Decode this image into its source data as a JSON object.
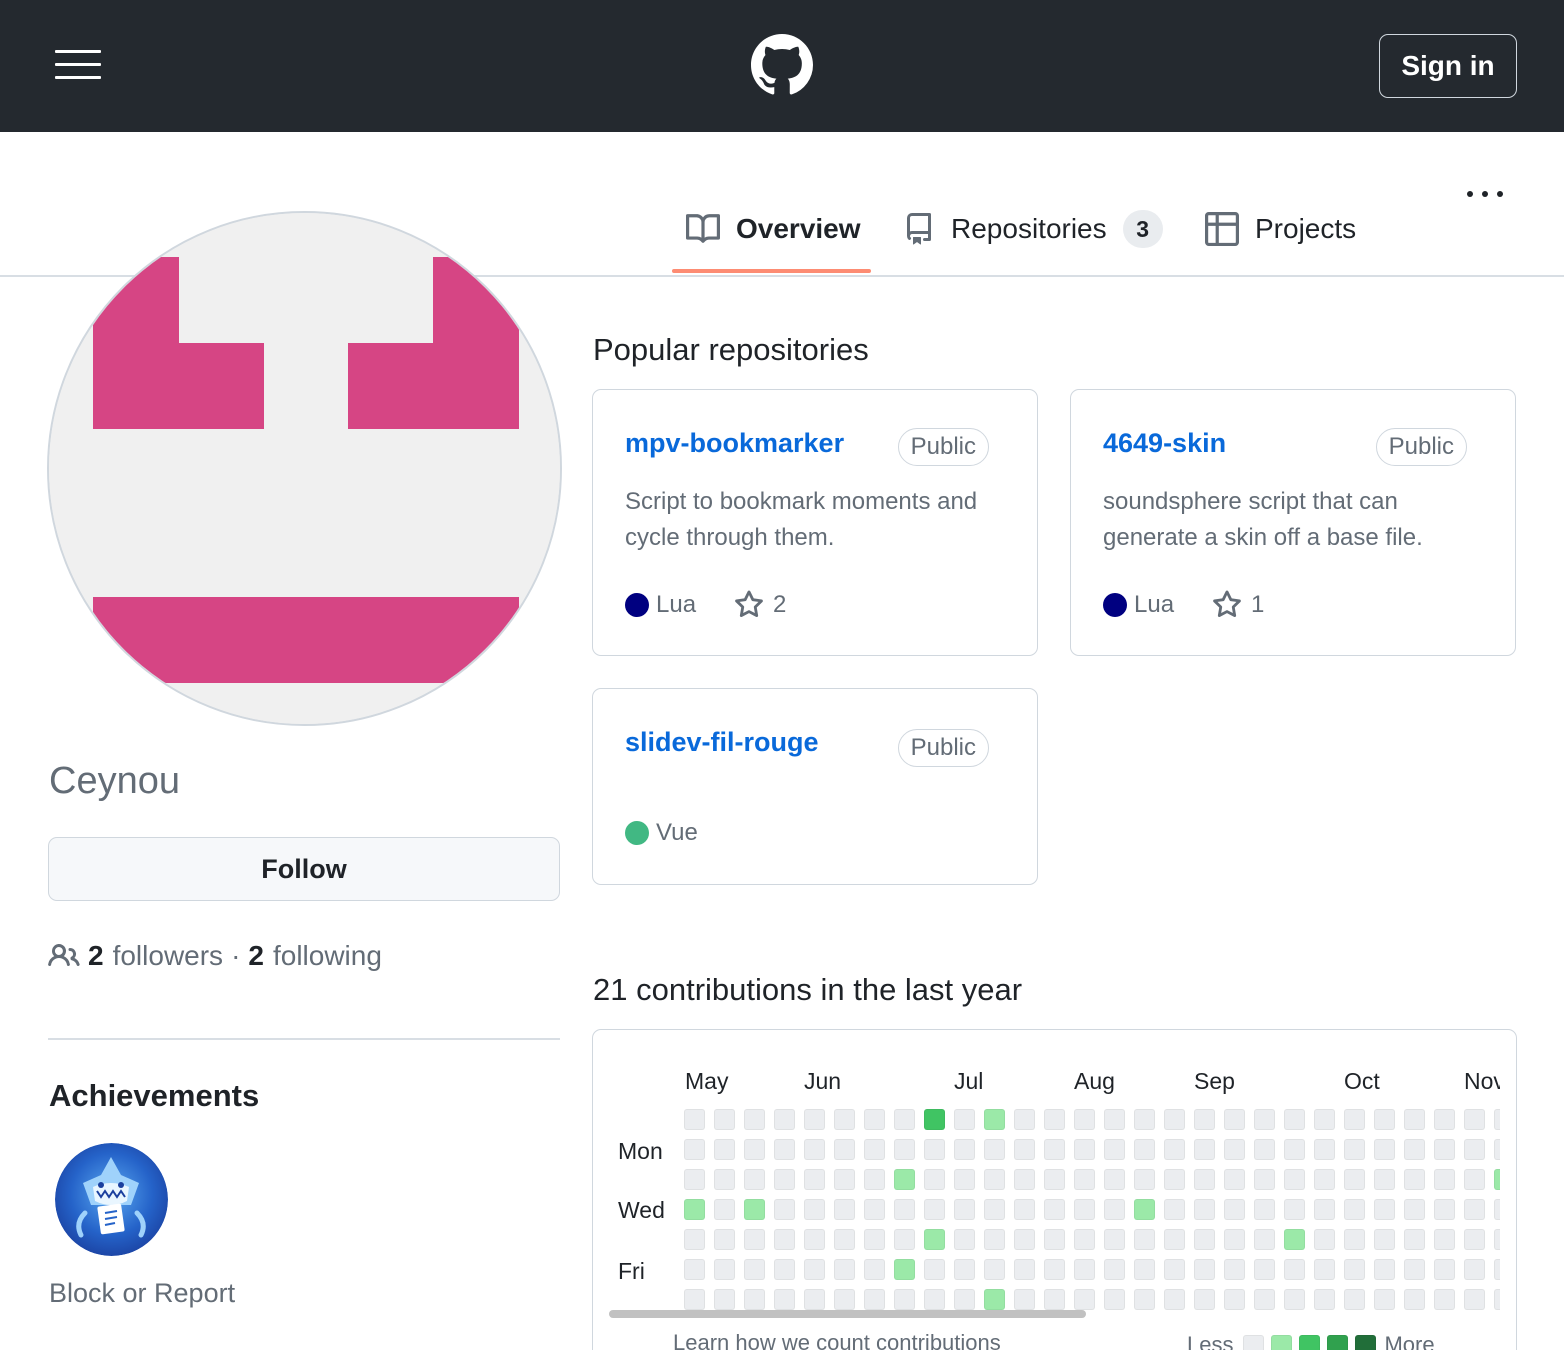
{
  "header": {
    "menu_icon": "hamburger-menu-icon",
    "logo_icon": "github-octocat-icon",
    "signin_label": "Sign in"
  },
  "tabs": [
    {
      "label": "Overview",
      "icon": "book-icon",
      "selected": true
    },
    {
      "label": "Repositories",
      "icon": "repo-icon",
      "count": "3"
    },
    {
      "label": "Projects",
      "icon": "table-icon"
    }
  ],
  "more_icon": "kebab-horizontal-icon",
  "profile": {
    "username": "Ceynou",
    "follow_label": "Follow",
    "followers_count": "2",
    "followers_label": "followers",
    "separator": "·",
    "following_count": "2",
    "following_label": "following",
    "achievements_title": "Achievements",
    "block_report_label": "Block or Report"
  },
  "popular": {
    "title": "Popular repositories",
    "repos": [
      {
        "name": "mpv-bookmarker",
        "visibility": "Public",
        "description": "Script to bookmark moments and cycle through them.",
        "language": "Lua",
        "language_color": "#000080",
        "stars": "2"
      },
      {
        "name": "4649-skin",
        "visibility": "Public",
        "description": "soundsphere script that can generate a skin off a base file.",
        "language": "Lua",
        "language_color": "#000080",
        "stars": "1"
      },
      {
        "name": "slidev-fil-rouge",
        "visibility": "Public",
        "description": "",
        "language": "Vue",
        "language_color": "#41b883"
      }
    ]
  },
  "contributions": {
    "title": "21 contributions in the last year",
    "months": [
      "May",
      "Jun",
      "Jul",
      "Aug",
      "Sep",
      "Oct",
      "Nov"
    ],
    "days": [
      "Mon",
      "Wed",
      "Fri"
    ],
    "levels_colors": [
      "#ebedf0",
      "#9be9a8",
      "#40c463",
      "#30a14e",
      "#216e39"
    ],
    "active_cells": [
      {
        "week": 8,
        "day": 0,
        "level": 2
      },
      {
        "week": 10,
        "day": 0,
        "level": 1
      },
      {
        "week": 7,
        "day": 2,
        "level": 1
      },
      {
        "week": 27,
        "day": 2,
        "level": 1
      },
      {
        "week": 0,
        "day": 3,
        "level": 1
      },
      {
        "week": 2,
        "day": 3,
        "level": 1
      },
      {
        "week": 15,
        "day": 3,
        "level": 1
      },
      {
        "week": 8,
        "day": 4,
        "level": 1
      },
      {
        "week": 20,
        "day": 4,
        "level": 1
      },
      {
        "week": 7,
        "day": 5,
        "level": 1
      },
      {
        "week": 10,
        "day": 6,
        "level": 1
      }
    ],
    "learn_label": "Learn how we count contributions",
    "less_label": "Less",
    "more_label": "More"
  }
}
